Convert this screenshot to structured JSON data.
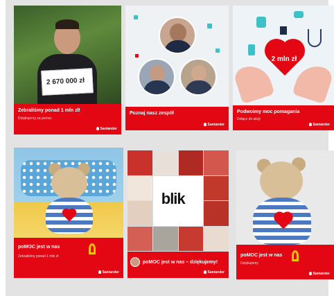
{
  "tiles": [
    {
      "caption": "Zebraliśmy ponad 1 mln zł!",
      "subcaption": "Dziękujemy za pomoc",
      "sign_text": "2 670 000 zł",
      "brand": "Santander"
    },
    {
      "caption": "Poznaj nasz zespół",
      "brand": "Santander"
    },
    {
      "caption": "Podwoimy moc pomagania",
      "subcaption": "Dołącz do akcji",
      "heart_text": "2 mln zł",
      "brand": "Santander"
    },
    {
      "caption": "poMOC jest w nas",
      "subcaption": "Zebraliśmy ponad 1 mln zł",
      "brand": "Santander"
    },
    {
      "caption": "poMOC jest w nas – dziękujemy!",
      "collage_word": "blik",
      "brand": "Santander"
    },
    {
      "caption": "poMOC jest w nas",
      "subcaption": "Dziękujemy",
      "brand": "Santander"
    }
  ],
  "colors": {
    "brand_red": "#e30613",
    "ribbon_gold": "#f5c400",
    "accent_teal": "#3ec0c8"
  }
}
